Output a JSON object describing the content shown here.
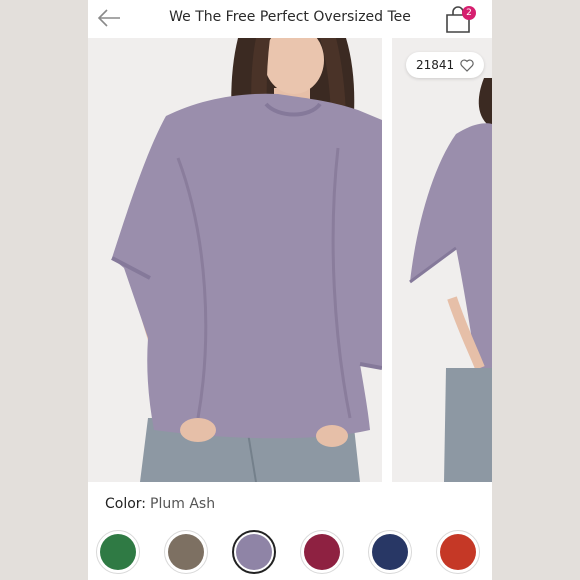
{
  "header": {
    "title": "We The Free Perfect Oversized Tee",
    "back_icon": "arrow-left-icon",
    "bag_icon": "shopping-bag-icon",
    "bag_count": "2"
  },
  "gallery": {
    "likes_count": "21841",
    "like_icon": "heart-outline-icon"
  },
  "color": {
    "label": "Color:",
    "value": "Plum Ash"
  },
  "swatches": [
    {
      "name": "green",
      "color": "#2f7a44",
      "selected": false
    },
    {
      "name": "brown",
      "color": "#7d7062",
      "selected": false
    },
    {
      "name": "plum-ash",
      "color": "#8f84a6",
      "selected": true
    },
    {
      "name": "berry",
      "color": "#8e2141",
      "selected": false
    },
    {
      "name": "navy",
      "color": "#283765",
      "selected": false
    },
    {
      "name": "red",
      "color": "#c53826",
      "selected": false
    }
  ],
  "colors": {
    "brand_badge": "#d61f6f",
    "shirt": "#968aa8"
  }
}
